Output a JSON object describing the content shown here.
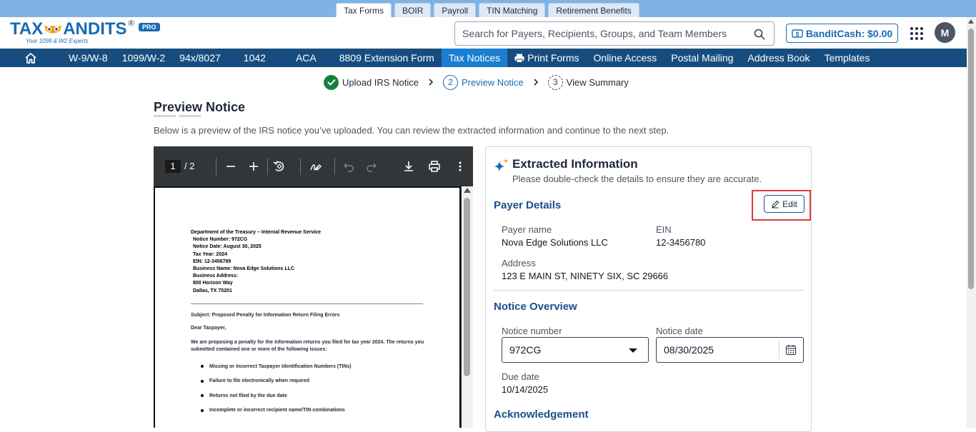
{
  "product_tabs": [
    {
      "label": "Tax Forms",
      "active": true
    },
    {
      "label": "BOIR",
      "active": false
    },
    {
      "label": "Payroll",
      "active": false
    },
    {
      "label": "TIN Matching",
      "active": false
    },
    {
      "label": "Retirement Benefits",
      "active": false
    }
  ],
  "header": {
    "logo_text_left": "TAX",
    "logo_text_right": "ANDITS",
    "logo_reg": "®",
    "logo_tagline": "Your 1099 & W2 Experts",
    "pro_badge": "PRO",
    "search_placeholder": "Search for Payers, Recipients, Groups, and Team Members",
    "banditcash_label": "BanditCash: $0.00",
    "avatar_initial": "M"
  },
  "nav": {
    "items": [
      {
        "label": "W-9/W-8",
        "active": false
      },
      {
        "label": "1099/W-2",
        "active": false
      },
      {
        "label": "94x/8027",
        "active": false
      },
      {
        "label": "1042",
        "active": false
      },
      {
        "label": "ACA",
        "active": false
      },
      {
        "label": "8809 Extension Form",
        "active": false
      },
      {
        "label": "Tax Notices",
        "active": true
      },
      {
        "label": "Print Forms",
        "active": false
      },
      {
        "label": "Online Access",
        "active": false
      },
      {
        "label": "Postal Mailing",
        "active": false
      },
      {
        "label": "Address Book",
        "active": false
      },
      {
        "label": "Templates",
        "active": false
      }
    ]
  },
  "stepper": {
    "steps": [
      {
        "label": "Upload IRS Notice",
        "number": "1",
        "state": "done"
      },
      {
        "label": "Preview Notice",
        "number": "2",
        "state": "active"
      },
      {
        "label": "View Summary",
        "number": "3",
        "state": "pending"
      }
    ]
  },
  "main": {
    "title": "Preview Notice",
    "subtitle": "Below is a preview of the IRS notice you’ve uploaded. You can review the extracted information and continue to the next step."
  },
  "pdf": {
    "current_page": "1",
    "total_pages": "/ 2",
    "header_lines": [
      "Department of the Treasury – Internal Revenue Service",
      "Notice Number: 972CG",
      "Notice Date: August 30, 2025",
      "Tax Year: 2024",
      "EIN: 12-3456789",
      "Business Name: Nova Edge Solutions LLC",
      "Business Address:",
      "800 Horizon Way",
      "Dallas, TX 75201"
    ],
    "subject": "Subject: Proposed Penalty for Information Return Filing Errors",
    "greeting": "Dear Taxpayer,",
    "paragraph": "We are proposing a penalty for the information returns you filed for tax year 2024. The returns you submitted contained one or more of the following issues:",
    "bullets": [
      "Missing or incorrect Taxpayer Identification Numbers (TINs)",
      "Failure to file electronically when required",
      "Returns not filed by the due date",
      "Incomplete or incorrect recipient name/TIN combinations"
    ]
  },
  "info": {
    "title": "Extracted Information",
    "subtitle": "Please double-check the details to ensure they are accurate.",
    "payer_section": "Payer Details",
    "edit_label": "Edit",
    "payer_name_label": "Payer name",
    "payer_name": "Nova Edge Solutions LLC",
    "ein_label": "EIN",
    "ein": "12-3456780",
    "address_label": "Address",
    "address": "123 E MAIN ST, NINETY SIX, SC 29666",
    "notice_section": "Notice Overview",
    "notice_number_label": "Notice number",
    "notice_number": "972CG",
    "notice_date_label": "Notice date",
    "notice_date": "08/30/2025",
    "due_date_label": "Due date",
    "due_date": "10/14/2025",
    "ack_section": "Acknowledgement"
  },
  "colors": {
    "brand": "#1a6ab3",
    "nav_bg": "#174d7e",
    "nav_active": "#1a7fd1",
    "highlight": "#e03c3c",
    "success": "#15803d"
  }
}
